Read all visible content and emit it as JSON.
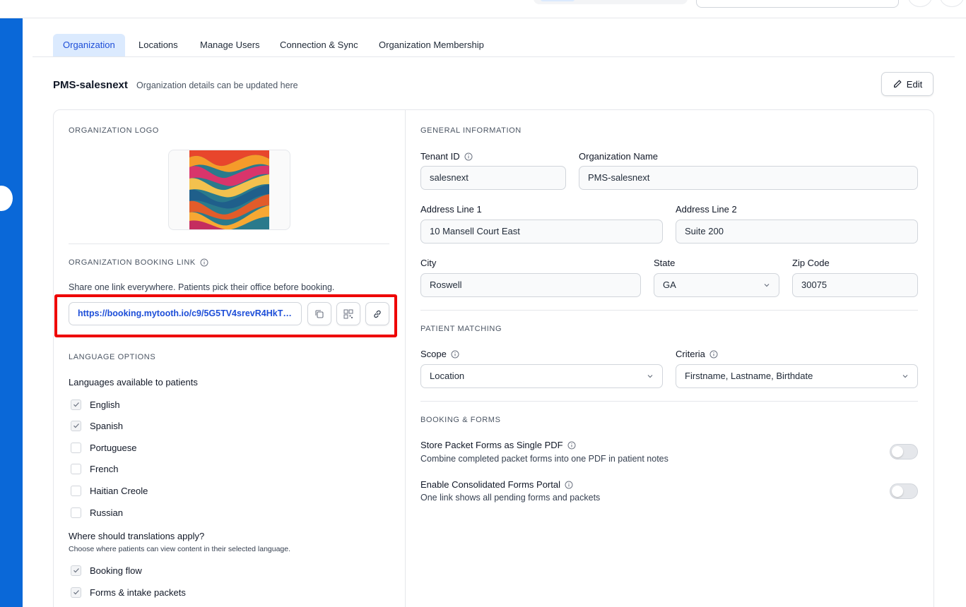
{
  "tabs": [
    {
      "label": "Organization",
      "active": true
    },
    {
      "label": "Locations",
      "active": false
    },
    {
      "label": "Manage Users",
      "active": false
    },
    {
      "label": "Connection & Sync",
      "active": false
    },
    {
      "label": "Organization Membership",
      "active": false
    }
  ],
  "header": {
    "title": "PMS-salesnext",
    "subtitle": "Organization details can be updated here",
    "edit_label": "Edit"
  },
  "left": {
    "logo_section": "ORGANIZATION LOGO",
    "booking_section": "ORGANIZATION BOOKING LINK",
    "booking_help": "Share one link everywhere. Patients pick their office before booking.",
    "booking_url": "https://booking.mytooth.io/c9/5G5TV4srevR4HkTE...",
    "language_section": "LANGUAGE OPTIONS",
    "languages_title": "Languages available to patients",
    "languages": [
      {
        "label": "English",
        "checked": true
      },
      {
        "label": "Spanish",
        "checked": true
      },
      {
        "label": "Portuguese",
        "checked": false
      },
      {
        "label": "French",
        "checked": false
      },
      {
        "label": "Haitian Creole",
        "checked": false
      },
      {
        "label": "Russian",
        "checked": false
      }
    ],
    "translations_title": "Where should translations apply?",
    "translations_note": "Choose where patients can view content in their selected language.",
    "translations": [
      {
        "label": "Booking flow",
        "checked": true
      },
      {
        "label": "Forms & intake packets",
        "checked": true
      }
    ]
  },
  "right": {
    "general_section": "GENERAL INFORMATION",
    "tenant_id_label": "Tenant ID",
    "tenant_id_value": "salesnext",
    "org_name_label": "Organization Name",
    "org_name_value": "PMS-salesnext",
    "address1_label": "Address Line 1",
    "address1_value": "10 Mansell Court East",
    "address2_label": "Address Line 2",
    "address2_value": "Suite 200",
    "city_label": "City",
    "city_value": "Roswell",
    "state_label": "State",
    "state_value": "GA",
    "zip_label": "Zip Code",
    "zip_value": "30075",
    "matching_section": "PATIENT MATCHING",
    "scope_label": "Scope",
    "scope_value": "Location",
    "criteria_label": "Criteria",
    "criteria_value": "Firstname, Lastname, Birthdate",
    "booking_forms_section": "BOOKING & FORMS",
    "single_pdf_title": "Store Packet Forms as Single PDF",
    "single_pdf_desc": "Combine completed packet forms into one PDF in patient notes",
    "single_pdf_on": false,
    "portal_title": "Enable Consolidated Forms Portal",
    "portal_desc": "One link shows all pending forms and packets",
    "portal_on": false
  },
  "colors": {
    "sidebar": "#0a68d8",
    "accent": "#1d4ed8",
    "active_tab_bg": "#dbeafe",
    "highlight": "#ee0000"
  }
}
